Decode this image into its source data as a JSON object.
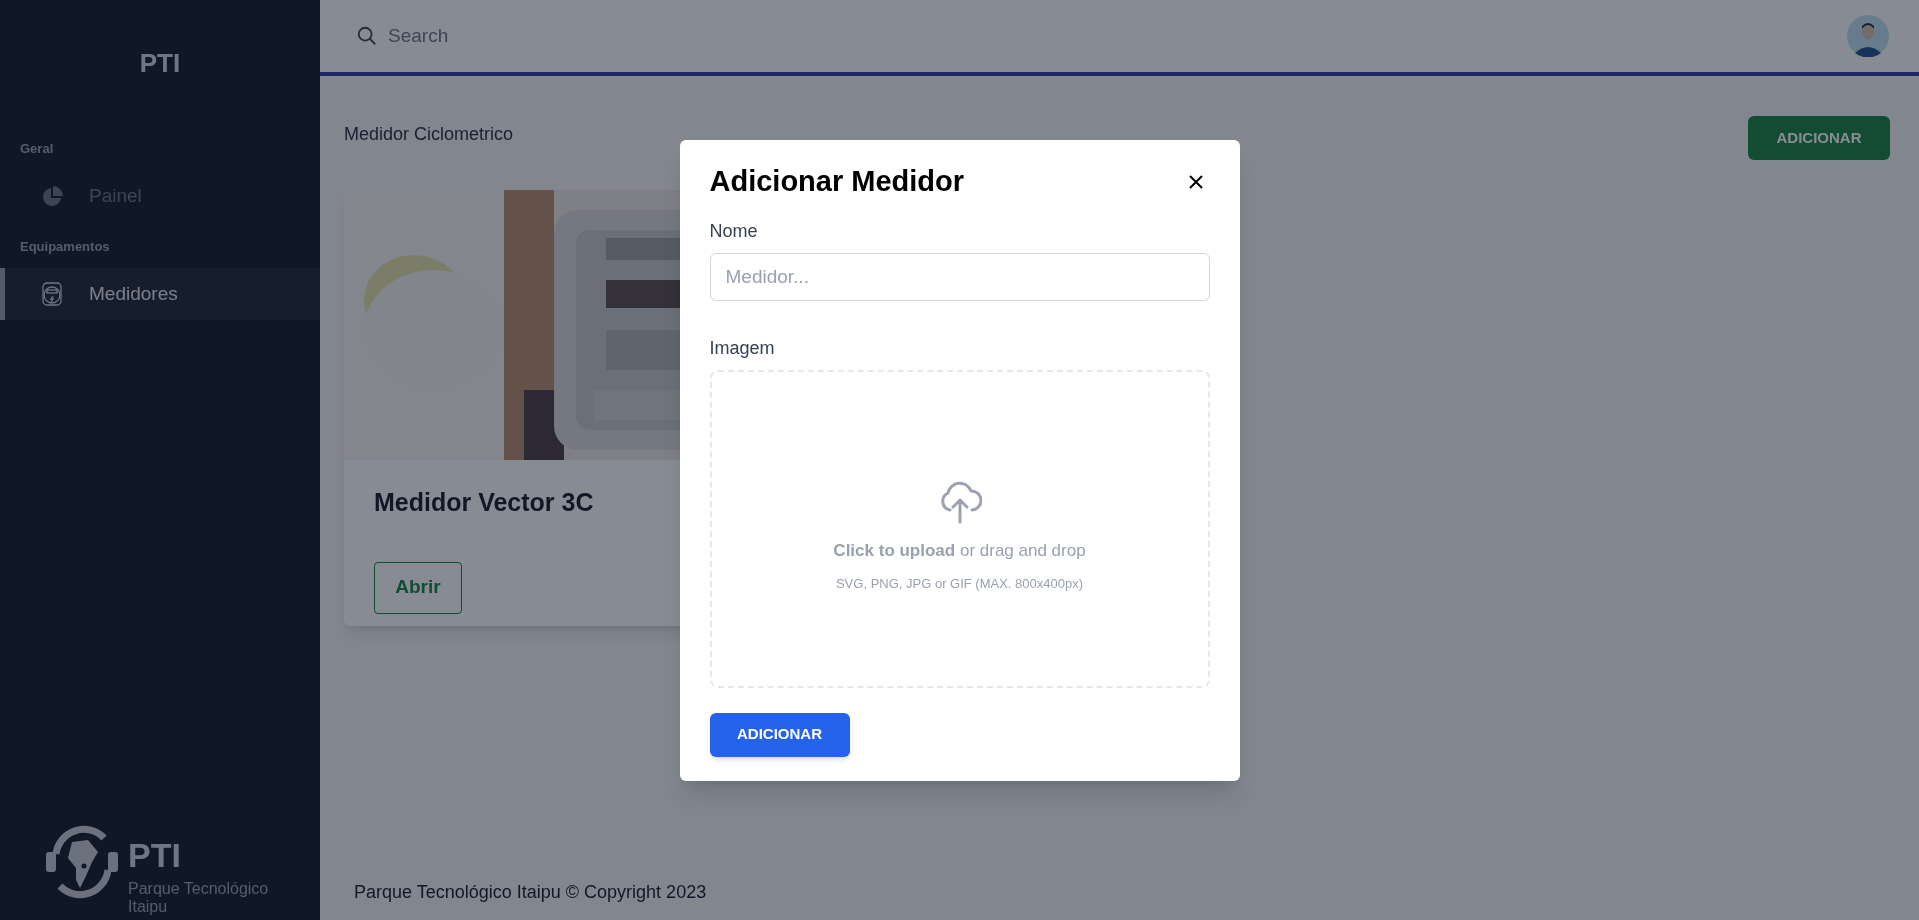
{
  "sidebar": {
    "title": "PTI",
    "sections": [
      {
        "heading": "Geral",
        "items": [
          {
            "label": "Painel",
            "kind": "pie",
            "selected": false
          }
        ]
      },
      {
        "heading": "Equipamentos",
        "items": [
          {
            "label": "Medidores",
            "kind": "meter",
            "selected": true
          }
        ]
      }
    ],
    "logo": {
      "mark": "PTI",
      "caption": "Parque Tecnológico Itaipu"
    }
  },
  "header": {
    "search": {
      "placeholder": "Search"
    }
  },
  "page": {
    "title": "Medidor Ciclometrico",
    "add_button": "ADICIONAR",
    "cards": [
      {
        "title": "Medidor Vector 3C",
        "button": "Abrir"
      }
    ]
  },
  "footer": "Parque Tecnológico Itaipu © Copyright 2023",
  "modal": {
    "title": "Adicionar Medidor",
    "name_label": "Nome",
    "name_placeholder": "Medidor...",
    "image_label": "Imagem",
    "upload_text": "**Click to upload** or drag and drop",
    "upload_hint": "SVG, PNG, JPG or GIF (MAX. 800x400px)",
    "submit": "ADICIONAR"
  }
}
